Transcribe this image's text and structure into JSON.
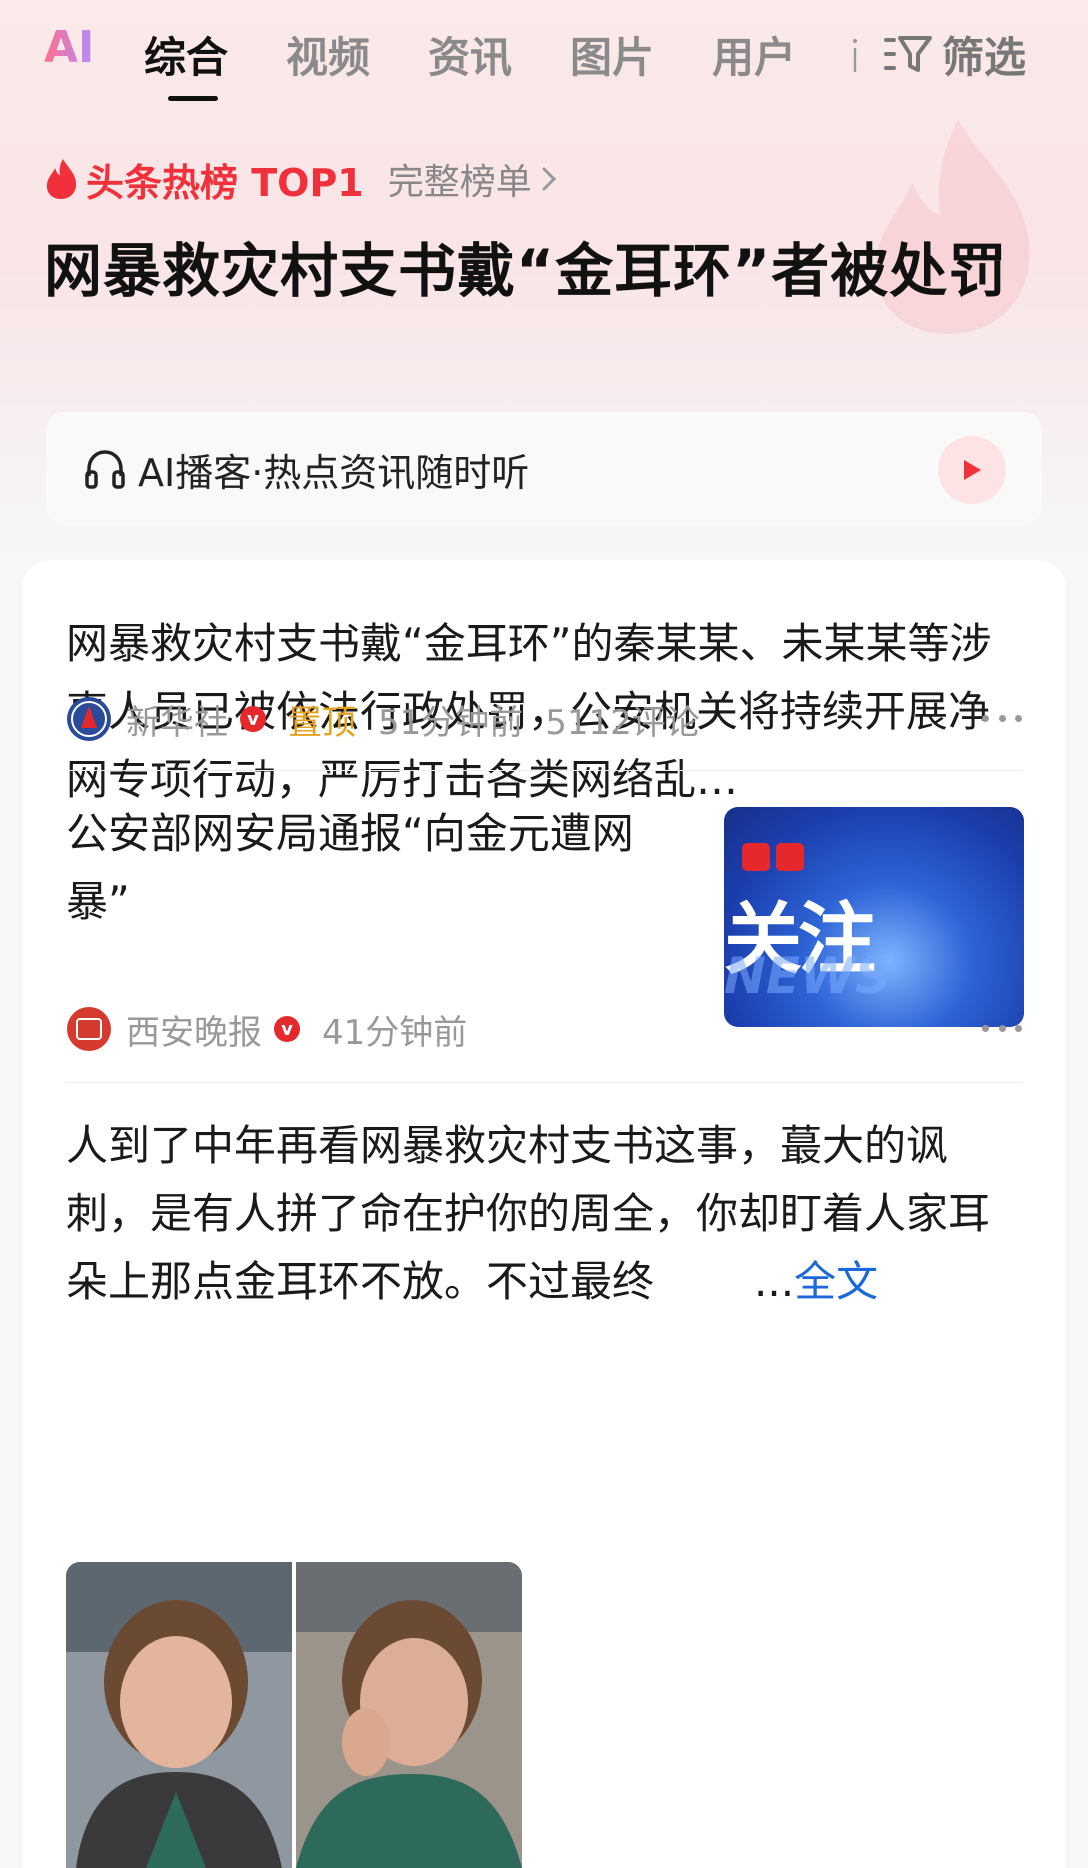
{
  "tabs": {
    "ai": "AI",
    "items": [
      "综合",
      "视频",
      "资讯",
      "图片",
      "用户"
    ],
    "filter": "筛选"
  },
  "hotlist": {
    "label": "头条热榜 TOP1",
    "full_list": "完整榜单",
    "headline": "网暴救灾村支书戴“金耳环”者被处罚"
  },
  "podcast": {
    "text": "AI播客·热点资讯随时听"
  },
  "feed": [
    {
      "text": "网暴救灾村支书戴“金耳环”的秦某某、未某某等涉事人员已被依法行政处罚，公安机关将持续开展净网专项行动，严厉打击各类网络乱…",
      "source": "新华社",
      "pinned": "置顶",
      "time": "51分钟前",
      "comments": "5112评论"
    },
    {
      "text": "公安部网安局通报“向金元遭网暴”",
      "source": "西安晚报",
      "time": "41分钟前",
      "thumb_title": "关注",
      "thumb_sub": "NEWS"
    },
    {
      "text": "人到了中年再看网暴救灾村支书这事，蕞大的讽刺，是有人拼了命在护你的周全，你却盯着人家耳朵上那点金耳环不放。不过最终",
      "ellipsis": "...",
      "full_text": "全文"
    }
  ],
  "colors": {
    "accent_red": "#f0313c",
    "link_blue": "#1b68d8",
    "pin_gold": "#e6a21e"
  }
}
